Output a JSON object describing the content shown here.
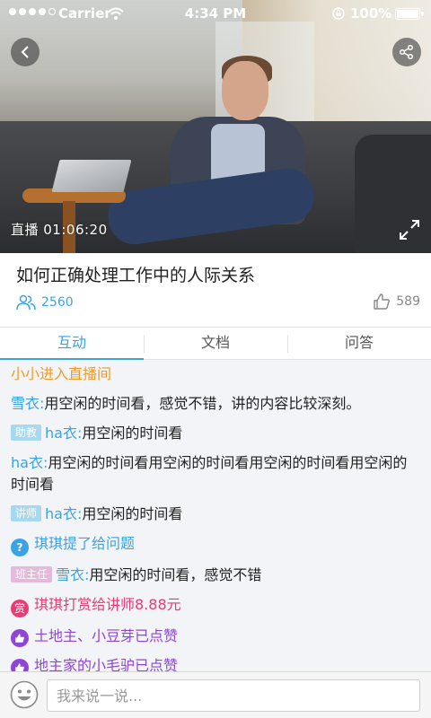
{
  "status_bar": {
    "carrier": "Carrier",
    "time": "4:34 PM",
    "battery": "100%"
  },
  "video": {
    "live_label": "直播 01:06:20"
  },
  "course": {
    "title": "如何正确处理工作中的人际关系",
    "viewers": "2560",
    "likes": "589"
  },
  "tabs": [
    {
      "label": "互动",
      "active": true
    },
    {
      "label": "文档",
      "active": false
    },
    {
      "label": "问答",
      "active": false
    }
  ],
  "chat": {
    "enter_notice": "小小进入直播间",
    "m1": {
      "name": "雪衣:",
      "text": "用空闲的时间看，感觉不错，讲的内容比较深刻。"
    },
    "m2": {
      "badge": "助教",
      "name": "ha衣:",
      "text": "用空闲的时间看"
    },
    "m3": {
      "name": "ha衣:",
      "text": "用空闲的时间看用空闲的时间看用空闲的时间看用空闲的时间看"
    },
    "m4": {
      "badge": "讲师",
      "name": "ha衣:",
      "text": "用空闲的时间看"
    },
    "question_notice": "琪琪提了给问题",
    "m5": {
      "badge": "班主任",
      "name": "雪衣:",
      "text": "用空闲的时间看，感觉不错"
    },
    "reward_icon": "赏",
    "reward_notice": "琪琪打赏给讲师8.88元",
    "like_notice_1": "土地主、小豆芽已点赞",
    "like_notice_2": "地主家的小毛驴已点赞"
  },
  "input": {
    "placeholder": "我来说一说..."
  },
  "colors": {
    "accent": "#3aa3e3",
    "enter": "#f39a1e",
    "reward": "#ea3b73",
    "like": "#8e46d3"
  }
}
